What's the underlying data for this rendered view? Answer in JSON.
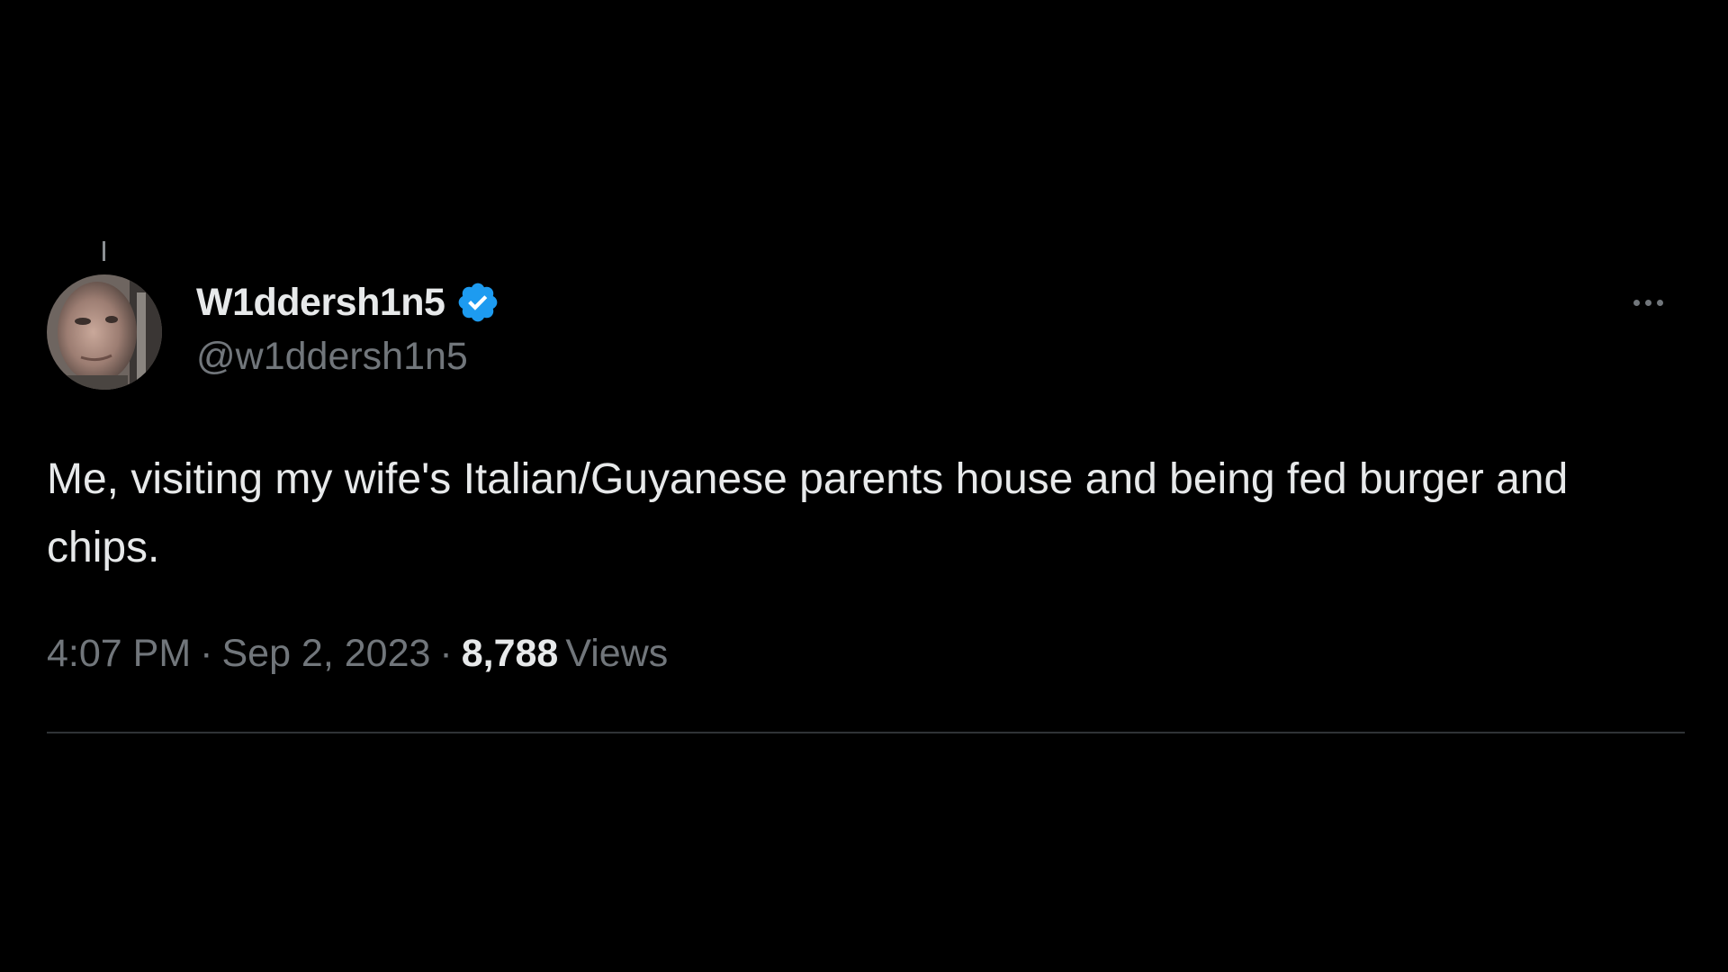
{
  "tweet": {
    "author": {
      "display_name": "W1ddersh1n5",
      "handle": "@w1ddersh1n5",
      "verified": true,
      "verified_color": "#1d9bf0",
      "avatar": "user-avatar-photo"
    },
    "text": "Me, visiting my wife's Italian/Guyanese parents house and being fed burger and chips.",
    "time": "4:07 PM",
    "separator": "·",
    "date": "Sep 2, 2023",
    "views_count": "8,788",
    "views_label": "Views",
    "more_icon": "more-horizontal-icon"
  },
  "colors": {
    "background": "#000000",
    "primary_text": "#e7e9ea",
    "secondary_text": "#71767b",
    "divider": "#2f3336",
    "accent": "#1d9bf0"
  }
}
